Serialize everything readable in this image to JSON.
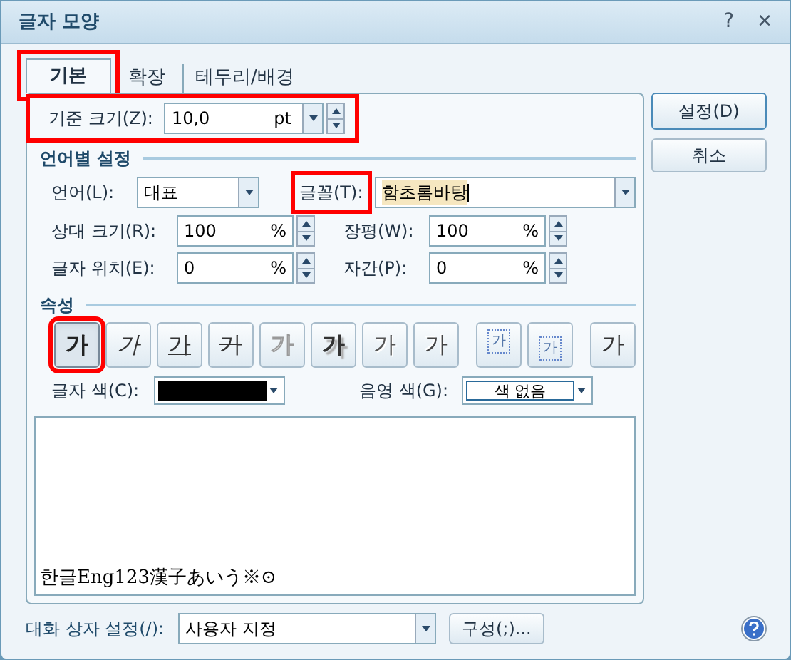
{
  "window": {
    "title": "글자 모양",
    "help_glyph": "?",
    "close_glyph": "✕"
  },
  "tabs": [
    {
      "label": "기본",
      "selected": true,
      "highlighted": true
    },
    {
      "label": "확장",
      "selected": false,
      "highlighted": false
    },
    {
      "label": "테두리/배경",
      "selected": false,
      "highlighted": false
    }
  ],
  "base_size": {
    "label": "기준 크기(Z):",
    "value": "10,0",
    "unit": "pt",
    "highlighted": true
  },
  "language_section": {
    "title": "언어별 설정",
    "language": {
      "label": "언어(L):",
      "value": "대표"
    },
    "font": {
      "label": "글꼴(T):",
      "value": "함초롬바탕",
      "highlighted": true
    },
    "fields": [
      {
        "label": "상대 크기(R):",
        "value": "100",
        "unit": "%"
      },
      {
        "label": "장평(W):",
        "value": "100",
        "unit": "%"
      },
      {
        "label": "글자 위치(E):",
        "value": "0",
        "unit": "%"
      },
      {
        "label": "자간(P):",
        "value": "0",
        "unit": "%"
      }
    ]
  },
  "attributes_section": {
    "title": "속성",
    "buttons": [
      {
        "label": "가",
        "kind": "bold",
        "selected": true,
        "highlighted": true
      },
      {
        "label": "가",
        "kind": "italic",
        "selected": false,
        "highlighted": false
      },
      {
        "label": "가",
        "kind": "underline",
        "selected": false,
        "highlighted": false
      },
      {
        "label": "가",
        "kind": "strike",
        "selected": false,
        "highlighted": false
      },
      {
        "label": "가",
        "kind": "outline",
        "selected": false,
        "highlighted": false
      },
      {
        "label": "가",
        "kind": "shadow",
        "selected": false,
        "highlighted": false
      },
      {
        "label": "가",
        "kind": "emboss",
        "selected": false,
        "highlighted": false
      },
      {
        "label": "가",
        "kind": "engrave",
        "selected": false,
        "highlighted": false
      },
      {
        "label": "가",
        "kind": "superscript",
        "selected": false,
        "highlighted": false
      },
      {
        "label": "가",
        "kind": "subscript",
        "selected": false,
        "highlighted": false
      },
      {
        "label": "가",
        "kind": "normal",
        "selected": false,
        "highlighted": false
      }
    ],
    "text_color": {
      "label": "글자 색(C):",
      "color": "#000000"
    },
    "shade_color": {
      "label": "음영 색(G):",
      "value": "색 없음"
    }
  },
  "preview": {
    "text": "한글Eng123漢子あいう※⊙"
  },
  "footer": {
    "label": "대화 상자 설정(/):",
    "value": "사용자 지정",
    "configure_button": "구성(;)..."
  },
  "side_buttons": [
    "설정(D)",
    "취소"
  ]
}
